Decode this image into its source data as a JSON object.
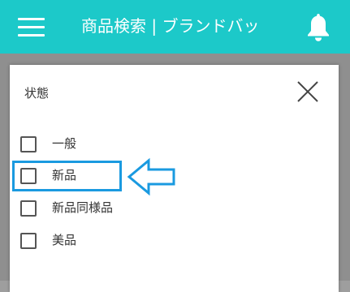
{
  "header": {
    "title": "商品検索 | ブランドバッ",
    "menu_icon": "hamburger-icon",
    "bell_icon": "bell-icon",
    "bg_color": "#1cc9c9"
  },
  "dialog": {
    "title": "状態",
    "close_icon": "close-icon",
    "options": [
      {
        "label": "一般",
        "checked": false
      },
      {
        "label": "新品",
        "checked": false
      },
      {
        "label": "新品同様品",
        "checked": false
      },
      {
        "label": "美品",
        "checked": false
      }
    ]
  },
  "annotation": {
    "highlight_color": "#1a9ae0",
    "arrow_icon": "left-arrow-icon",
    "highlighted_option": "新品"
  }
}
